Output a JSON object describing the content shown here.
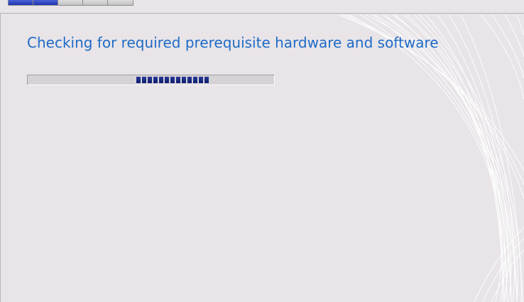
{
  "wizard": {
    "steps": [
      {
        "name": "step-1",
        "state": "complete"
      },
      {
        "name": "step-2",
        "state": "complete"
      },
      {
        "name": "step-3",
        "state": "pending"
      },
      {
        "name": "step-4",
        "state": "pending"
      },
      {
        "name": "step-5",
        "state": "pending"
      }
    ]
  },
  "main": {
    "title": "Checking for required prerequisite hardware and software",
    "progress": {
      "mode": "indeterminate",
      "segment_count": 13
    }
  },
  "colors": {
    "background": "#e8e4e8",
    "title": "#1e6bc6",
    "progress_fill": "#0c1c70",
    "step_complete": "#1f34b0"
  }
}
